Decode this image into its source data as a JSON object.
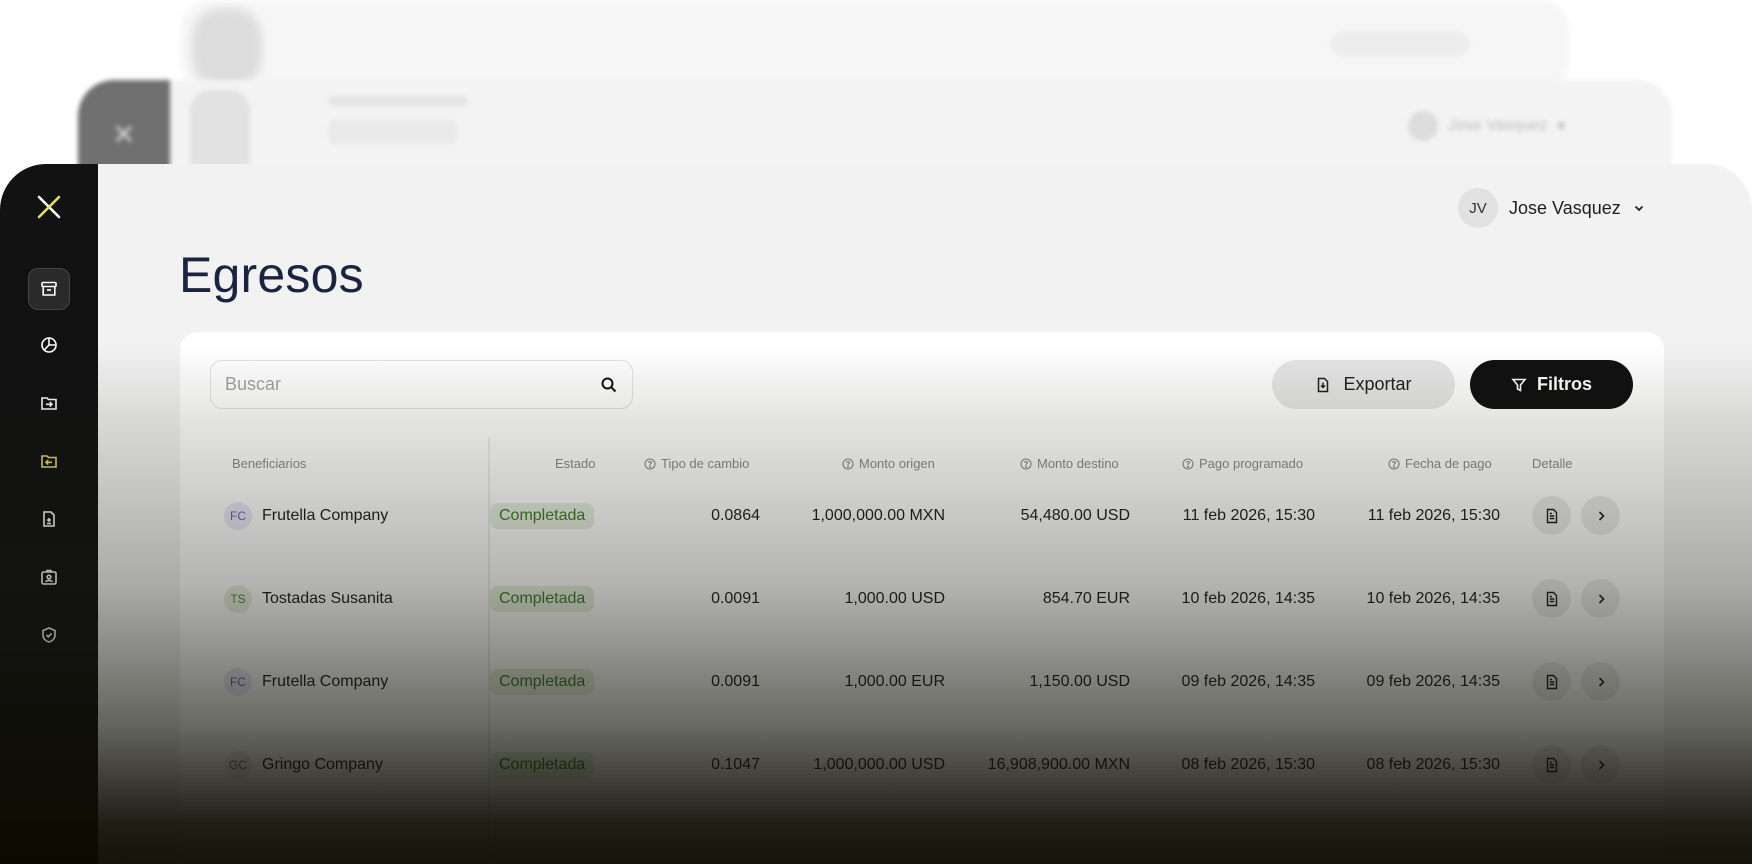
{
  "background": {
    "ghost_user_name": "Jose Vasquez"
  },
  "user": {
    "initials": "JV",
    "name": "Jose Vasquez"
  },
  "page": {
    "title": "Egresos"
  },
  "search": {
    "placeholder": "Buscar"
  },
  "toolbar": {
    "export_label": "Exportar",
    "filters_label": "Filtros"
  },
  "table": {
    "headers": {
      "beneficiaries": "Beneficiarios",
      "status": "Estado",
      "exchange_rate": "Tipo de cambio",
      "source_amount": "Monto origen",
      "destination_amount": "Monto destino",
      "scheduled_payment": "Pago programado",
      "payment_date": "Fecha de pago",
      "detail": "Detalle"
    },
    "rows": [
      {
        "initials": "FC",
        "beneficiary": "Frutella Company",
        "status": "Completada",
        "exchange_rate": "0.0864",
        "source_amount": "1,000,000.00 MXN",
        "destination_amount": "54,480.00 USD",
        "scheduled_payment": "11 feb 2026, 15:30",
        "payment_date": "11 feb 2026, 15:30"
      },
      {
        "initials": "TS",
        "beneficiary": "Tostadas Susanita",
        "status": "Completada",
        "exchange_rate": "0.0091",
        "source_amount": "1,000.00 USD",
        "destination_amount": "854.70 EUR",
        "scheduled_payment": "10 feb 2026, 14:35",
        "payment_date": "10 feb 2026, 14:35"
      },
      {
        "initials": "FC",
        "beneficiary": "Frutella Company",
        "status": "Completada",
        "exchange_rate": "0.0091",
        "source_amount": "1,000.00 EUR",
        "destination_amount": "1,150.00 USD",
        "scheduled_payment": "09 feb 2026, 14:35",
        "payment_date": "09 feb 2026, 14:35"
      },
      {
        "initials": "GC",
        "beneficiary": "Gringo Company",
        "status": "Completada",
        "exchange_rate": "0.1047",
        "source_amount": "1,000,000.00 USD",
        "destination_amount": "16,908,900.00 MXN",
        "scheduled_payment": "08 feb 2026, 15:30",
        "payment_date": "08 feb 2026, 15:30"
      }
    ]
  },
  "colors": {
    "sidebar": "#121212",
    "accent_logo": "#e6dd6a",
    "title": "#1a2440",
    "status_bg": "#e6f0df",
    "status_text": "#3e7a2e",
    "initials_fc": "#6b5fb5",
    "initials_ts": "#4f8a3a"
  },
  "icons": {
    "sidebar": [
      "archive-icon",
      "chart-pie-icon",
      "folder-in-icon",
      "folder-out-icon",
      "document-icon",
      "user-badge-icon",
      "shield-check-icon"
    ]
  }
}
